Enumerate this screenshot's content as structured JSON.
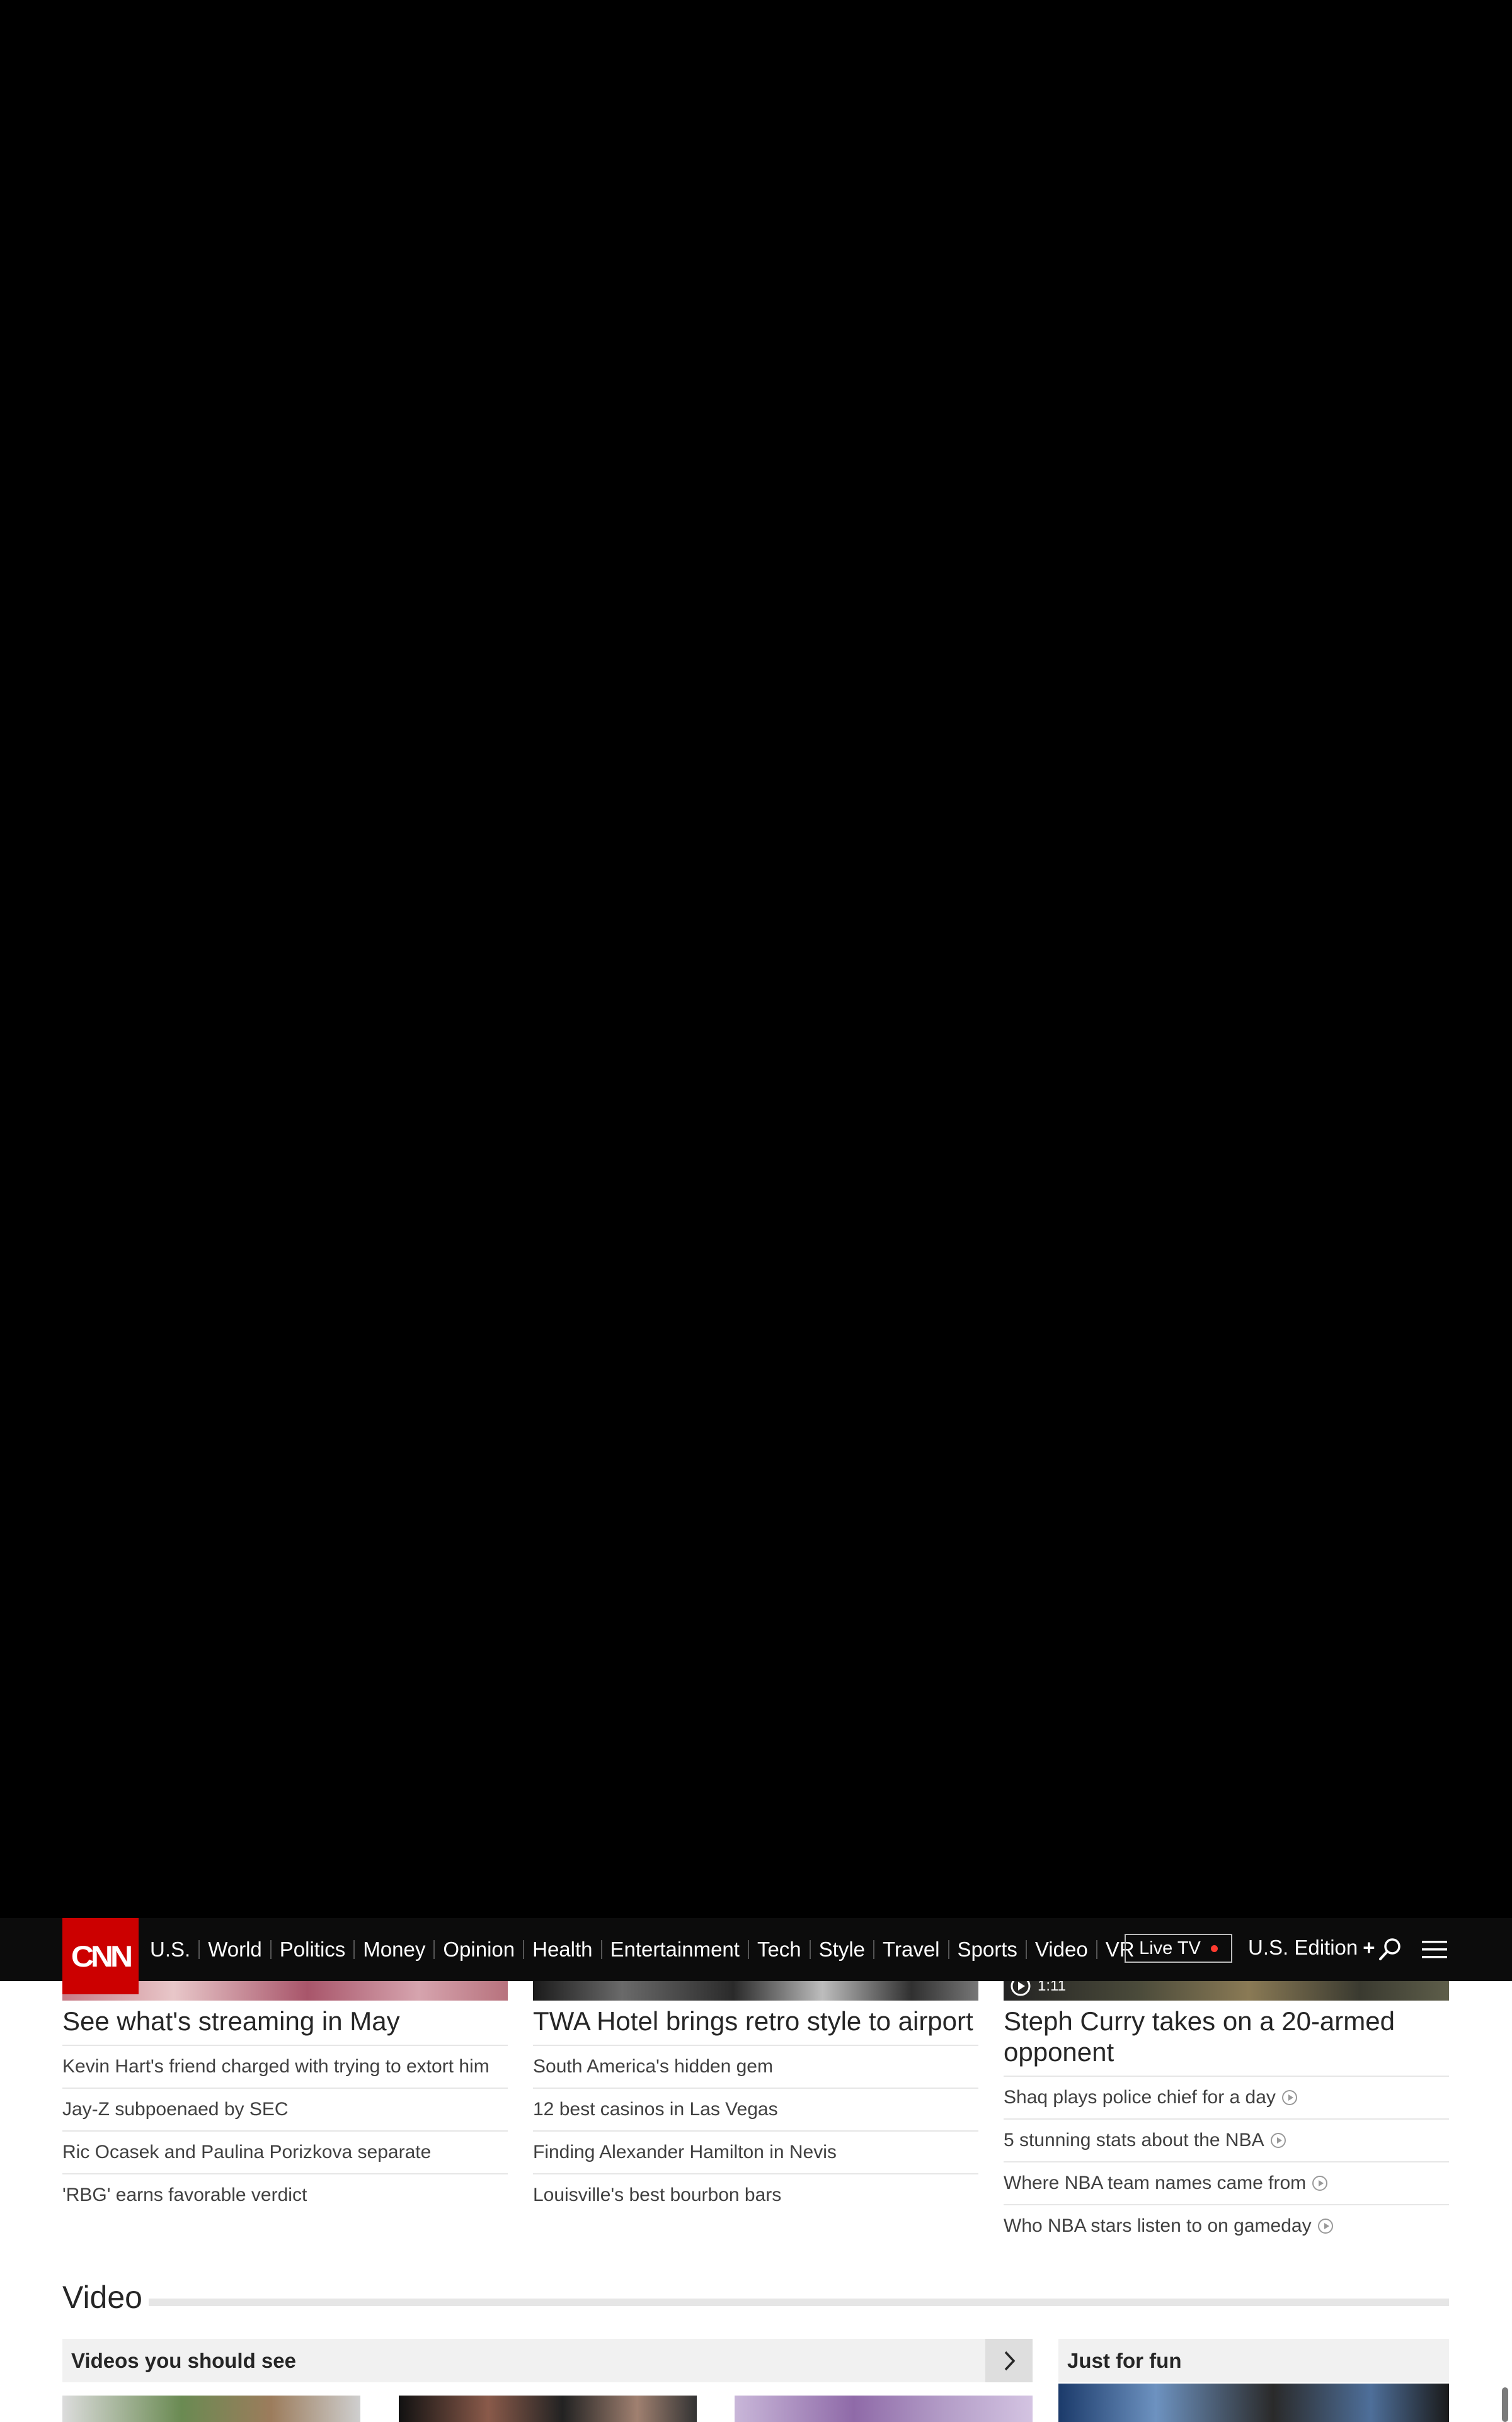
{
  "nav": {
    "logo": "CNN",
    "links": [
      "U.S.",
      "World",
      "Politics",
      "Money",
      "Opinion",
      "Health",
      "Entertainment",
      "Tech",
      "Style",
      "Travel",
      "Sports",
      "Video",
      "VR"
    ],
    "live_tv": "Live TV",
    "edition": "U.S. Edition",
    "edition_plus": "+",
    "icons": [
      "search-icon",
      "menu-icon"
    ]
  },
  "columns": [
    {
      "headline": "See what's streaming in May",
      "items": [
        "Kevin Hart's friend charged with trying to extort him",
        "Jay-Z subpoenaed by SEC",
        "Ric Ocasek and Paulina Porizkova separate",
        "'RBG' earns favorable verdict"
      ]
    },
    {
      "headline": "TWA Hotel brings retro style to airport",
      "items": [
        "South America's hidden gem",
        "12 best casinos in Las Vegas",
        "Finding Alexander Hamilton in Nevis",
        "Louisville's best bourbon bars"
      ]
    },
    {
      "headline": "Steph Curry takes on a 20-armed opponent",
      "video_duration": "1:11",
      "items": [
        "Shaq plays police chief for a day",
        "5 stunning stats about the NBA",
        "Where NBA team names came from",
        "Who NBA stars listen to on gameday"
      ]
    }
  ],
  "video_section": {
    "title": "Video",
    "carousel_title": "Videos you should see",
    "fun_title": "Just for fun"
  },
  "colors": {
    "brand_red": "#cc0000",
    "nav_bg": "#0c0c0c",
    "live_dot": "#ff3b30"
  }
}
